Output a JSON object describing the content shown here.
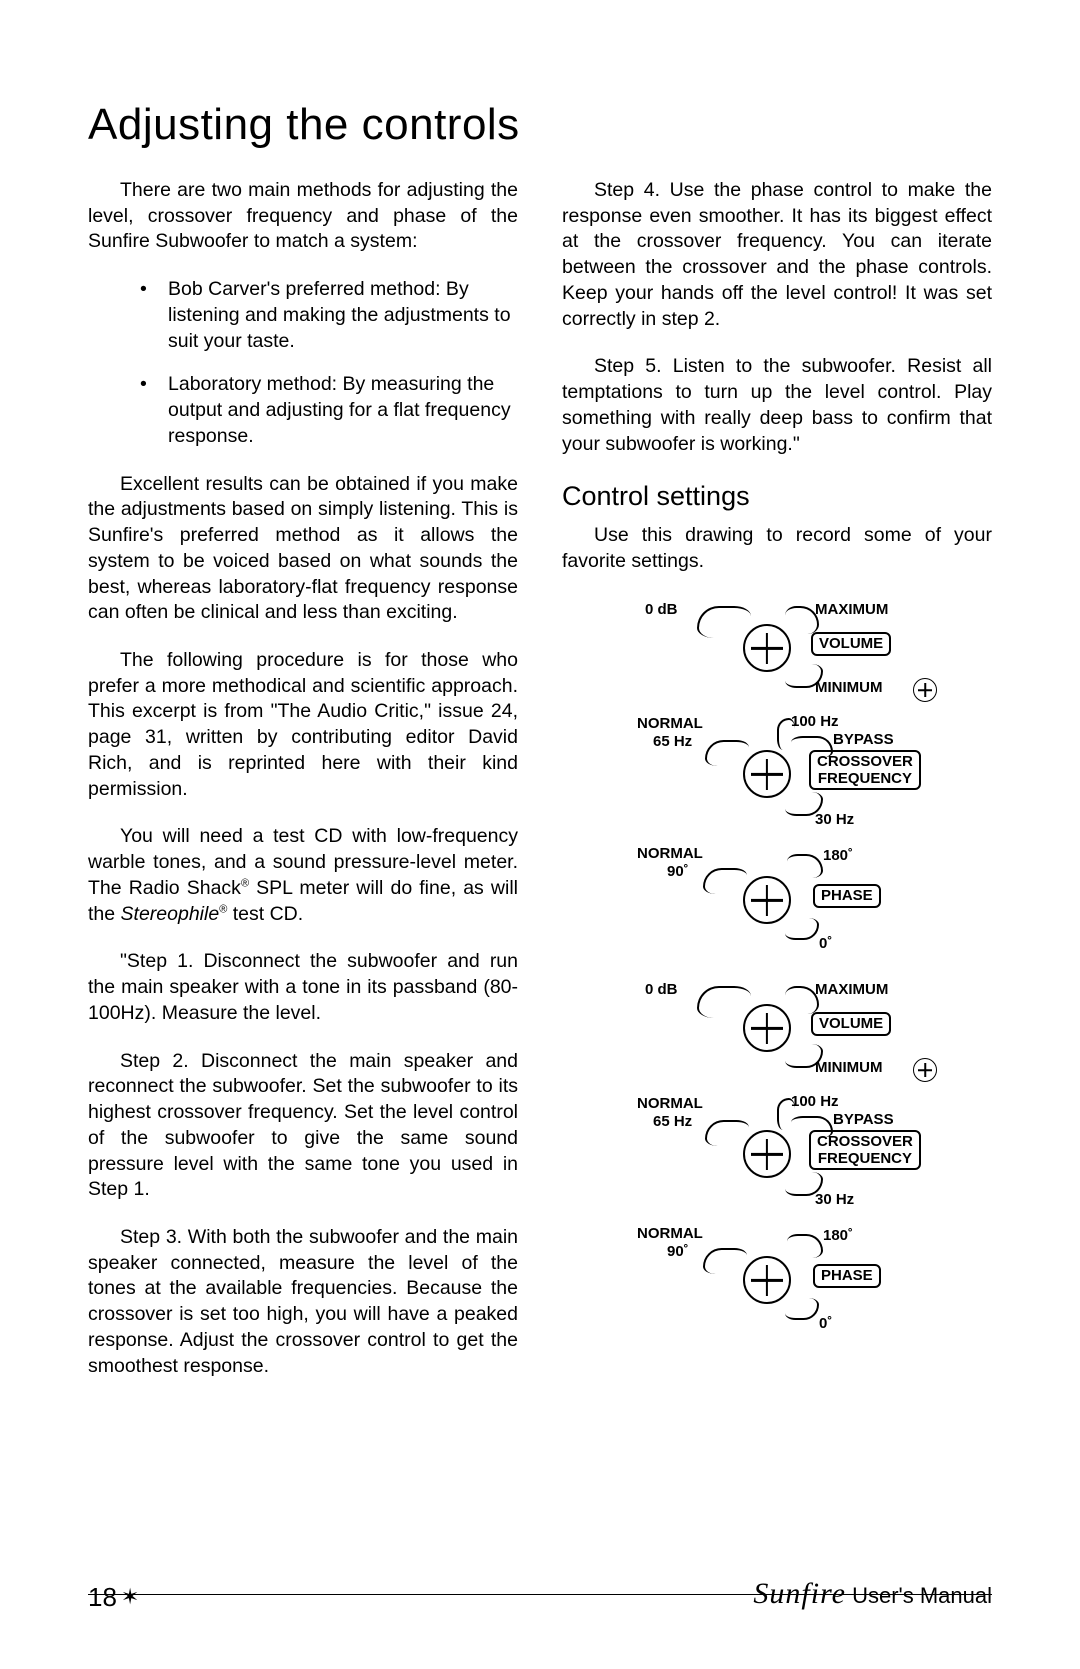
{
  "heading": "Adjusting the controls",
  "col1": {
    "intro": "There are two main methods for adjusting the level, crossover frequency and phase of the Sunfire Subwoofer to match a system:",
    "bullets": [
      "Bob Carver's preferred method: By listening and making the adjustments to suit your taste.",
      "Laboratory method: By measuring the output and adjusting for a flat frequency response."
    ],
    "para2": "Excellent results can be obtained if you make the adjustments based on simply listening. This is Sunfire's preferred method as it allows the system to be voiced based on what sounds the best, whereas laboratory-flat frequency response can often be clinical and less than exciting.",
    "para3": "The following procedure is for those who prefer a more methodical and scientific approach. This excerpt is from \"The Audio Critic,\" issue 24, page 31, written by contributing editor David Rich, and is reprinted here with their kind permission.",
    "para4_pre": "You will need a test CD with low-frequency warble tones, and a sound pressure-level meter. The Radio Shack",
    "para4_mid1": " SPL meter will do fine, as will the ",
    "para4_mid2": "Stereophile",
    "para4_post": " test CD.",
    "step1": "\"Step 1.  Disconnect the subwoofer and run the main speaker with a tone in its passband (80-100Hz). Measure the level.",
    "step2": "Step 2.  Disconnect the main speaker and reconnect the subwoofer. Set the subwoofer to its highest crossover frequency. Set the level control of the subwoofer to give the same sound pressure level with the same tone you used in Step 1.",
    "step3": "Step 3.  With both the subwoofer and the main speaker connected, measure the level of the tones at the available frequencies.  Because the crossover is set too high, you will have a peaked response. Adjust the crossover control to get the smoothest response."
  },
  "col2": {
    "step4": "Step 4.  Use the phase control to make the response even smoother. It has its biggest effect at the crossover frequency. You can iterate between the crossover and the phase controls. Keep your hands off the level control! It was set correctly in step 2.",
    "step5": "Step 5.  Listen to the subwoofer. Resist all temptations to turn up the level control. Play something with really deep bass to confirm that your subwoofer is working.\"",
    "subheading": "Control settings",
    "subintro": "Use this drawing to record some of your favorite settings."
  },
  "diagram_labels": {
    "volume": {
      "tl": "0 dB",
      "tr": "MAXIMUM",
      "box": "VOLUME",
      "br": "MINIMUM"
    },
    "crossover": {
      "tl1": "NORMAL",
      "tl2": "65 Hz",
      "tc": "100 Hz",
      "tr": "BYPASS",
      "box1": "CROSSOVER",
      "box2": "FREQUENCY",
      "bc": "30 Hz"
    },
    "phase": {
      "tl1": "NORMAL",
      "tl2": "90˚",
      "tr": "180˚",
      "box": "PHASE",
      "bc": "0˚"
    }
  },
  "footer": {
    "page": "18",
    "brand": "Sunfire",
    "tail": " User's Manual"
  }
}
